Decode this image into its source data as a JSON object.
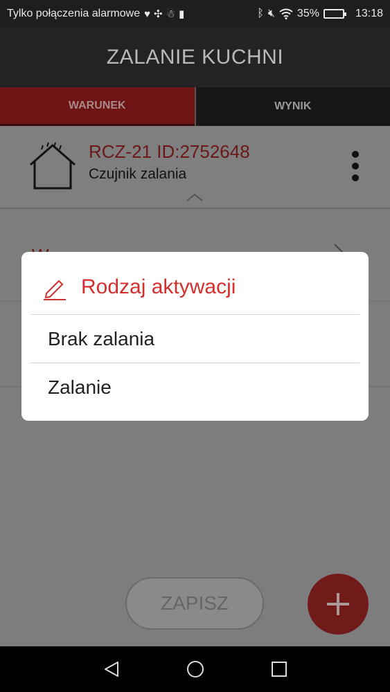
{
  "status_bar": {
    "carrier_text": "Tylko połączenia alarmowe",
    "battery_percent": "35%",
    "battery_level": 0.35,
    "time": "13:18",
    "icons": [
      "heart-icon",
      "fan-icon",
      "person-icon",
      "sim-alert-icon",
      "bluetooth-icon",
      "mute-icon",
      "wifi-icon",
      "battery-icon"
    ]
  },
  "app_bar": {
    "title": "ZALANIE KUCHNI"
  },
  "tabs": [
    {
      "label": "WARUNEK",
      "active": true
    },
    {
      "label": "WYNIK",
      "active": false
    }
  ],
  "device": {
    "id": "RCZ-21 ID:2752648",
    "type": "Czujnik zalania",
    "icon": "house-rain-icon"
  },
  "save_button": {
    "label": "ZAPISZ"
  },
  "fab": {
    "icon": "plus-icon"
  },
  "dialog": {
    "title": "Rodzaj aktywacji",
    "icon": "pencil-icon",
    "options": [
      "Brak zalania",
      "Zalanie"
    ]
  },
  "nav_bar": {
    "icons": [
      "back-icon",
      "home-icon",
      "recents-icon"
    ]
  },
  "colors": {
    "accent": "#d32f2f",
    "dim_overlay": "#7d7d7d"
  }
}
